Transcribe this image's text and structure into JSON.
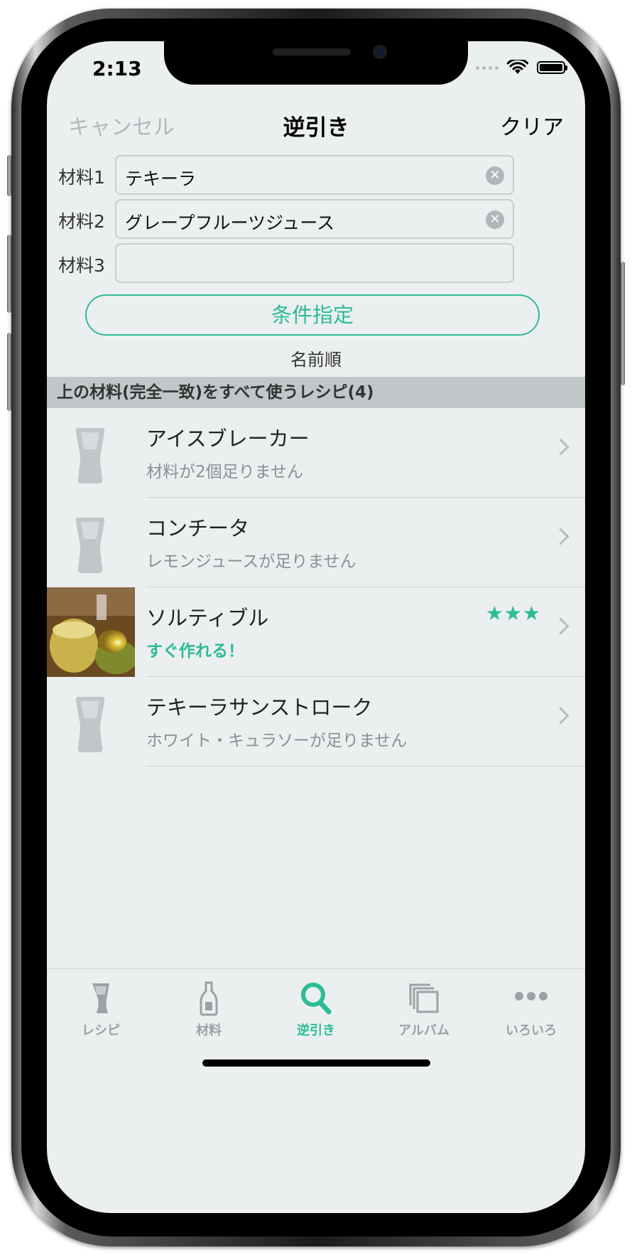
{
  "status_bar": {
    "time": "2:13"
  },
  "nav": {
    "cancel": "キャンセル",
    "title": "逆引き",
    "clear": "クリア"
  },
  "form": {
    "ingredients": [
      {
        "label": "材料1",
        "value": "テキーラ"
      },
      {
        "label": "材料2",
        "value": "グレープフルーツジュース"
      },
      {
        "label": "材料3",
        "value": ""
      }
    ],
    "condition_button": "条件指定",
    "sort_label": "名前順"
  },
  "section_header": "上の材料(完全一致)をすべて使うレシピ(4)",
  "recipes": [
    {
      "name": "アイスブレーカー",
      "subtitle": "材料が2個足りません",
      "has_photo": false
    },
    {
      "name": "コンチータ",
      "subtitle": "レモンジュースが足りません",
      "has_photo": false
    },
    {
      "name": "ソルティブル",
      "subtitle": "すぐ作れる！",
      "has_photo": true,
      "rating": "★★★"
    },
    {
      "name": "テキーラサンストローク",
      "subtitle": "ホワイト・キュラソーが足りません",
      "has_photo": false
    }
  ],
  "tabbar": {
    "tabs": [
      {
        "label": "レシピ",
        "icon": "glass-icon"
      },
      {
        "label": "材料",
        "icon": "bottle-icon"
      },
      {
        "label": "逆引き",
        "icon": "search-icon",
        "active": true
      },
      {
        "label": "アルバム",
        "icon": "album-icon"
      },
      {
        "label": "いろいろ",
        "icon": "more-icon"
      }
    ]
  },
  "colors": {
    "accent": "#2cbc96",
    "background": "#eceff0",
    "section": "#c1c6c9"
  }
}
